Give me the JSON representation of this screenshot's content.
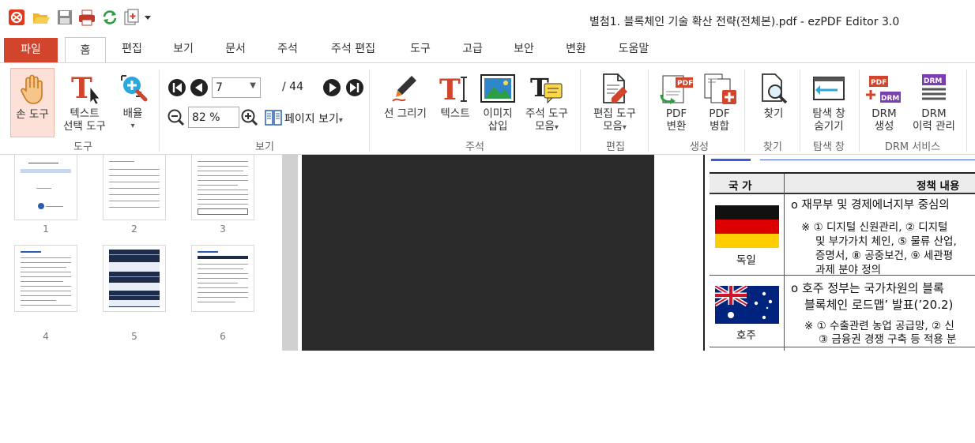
{
  "window": {
    "title": "별첨1. 블록체인 기술 확산 전략(전체본).pdf -  ezPDF Editor 3.0"
  },
  "quick_access": [
    {
      "name": "app-logo-icon"
    },
    {
      "name": "open-folder-icon"
    },
    {
      "name": "save-icon"
    },
    {
      "name": "print-icon"
    },
    {
      "name": "refresh-icon"
    },
    {
      "name": "add-page-icon"
    },
    {
      "name": "customize-dropdown-icon"
    }
  ],
  "menu": {
    "file": "파일",
    "tabs": [
      "홈",
      "편집",
      "보기",
      "문서",
      "주석",
      "주석 편집",
      "도구",
      "고급",
      "보안",
      "변환",
      "도움말"
    ]
  },
  "ribbon": {
    "hand_tool": "손 도구",
    "text_select_1": "텍스트",
    "text_select_2": "선택 도구",
    "zoom_1": "배율",
    "group_tool": "도구",
    "page_current": "7",
    "page_total": "/ 44",
    "zoom_value": "82 %",
    "page_view": "페이지 보기",
    "group_view": "보기",
    "line_draw": "선 그리기",
    "text": "텍스트",
    "image_1": "이미지",
    "image_2": "삽입",
    "annot_tools_1": "주석 도구",
    "annot_tools_2": "모음",
    "group_annot": "주석",
    "edit_tools_1": "편집 도구",
    "edit_tools_2": "모음",
    "group_edit": "편집",
    "pdf_convert_1": "PDF",
    "pdf_convert_2": "변환",
    "pdf_merge_1": "PDF",
    "pdf_merge_2": "병합",
    "group_create": "생성",
    "find": "찾기",
    "group_find": "찾기",
    "nav_hide_1": "탐색 창",
    "nav_hide_2": "숨기기",
    "group_nav": "탐색 창",
    "drm_create_1": "DRM",
    "drm_create_2": "생성",
    "drm_history_1": "DRM",
    "drm_history_2": "이력 관리",
    "group_drm": "DRM 서비스"
  },
  "thumbnails": [
    {
      "num": "1"
    },
    {
      "num": "2"
    },
    {
      "num": "3"
    },
    {
      "num": "4"
    },
    {
      "num": "5"
    },
    {
      "num": "6"
    }
  ],
  "doc": {
    "col_country": "국   가",
    "col_policy": "정책 내용",
    "germany_name": "독일",
    "germany_l1": "o  재무부 및 경제에너지부 중심의",
    "germany_l2": "※  ① 디지털 신원관리, ② 디지털 ",
    "germany_l3": "및 부가가치 체인, ⑤ 물류 산업,",
    "germany_l4": "증명서, ⑧ 공중보건, ⑨ 세관평",
    "germany_l5": "과제 분야 정의",
    "australia_name": "호주",
    "australia_l1": "o  호주 정부는 국가차원의 블록",
    "australia_l2": "블록체인 로드맵’ 발표(’20.2)",
    "australia_l3": "※ ① 수출관련 농업 공급망, ② 신",
    "australia_l4": "③ 금융권 경쟁 구축 등 적용 분"
  },
  "colors": {
    "file_tab": "#d2442b",
    "accent_blue": "#3a5bd9",
    "flag_red": "#dd0000",
    "flag_gold": "#ffce00"
  }
}
